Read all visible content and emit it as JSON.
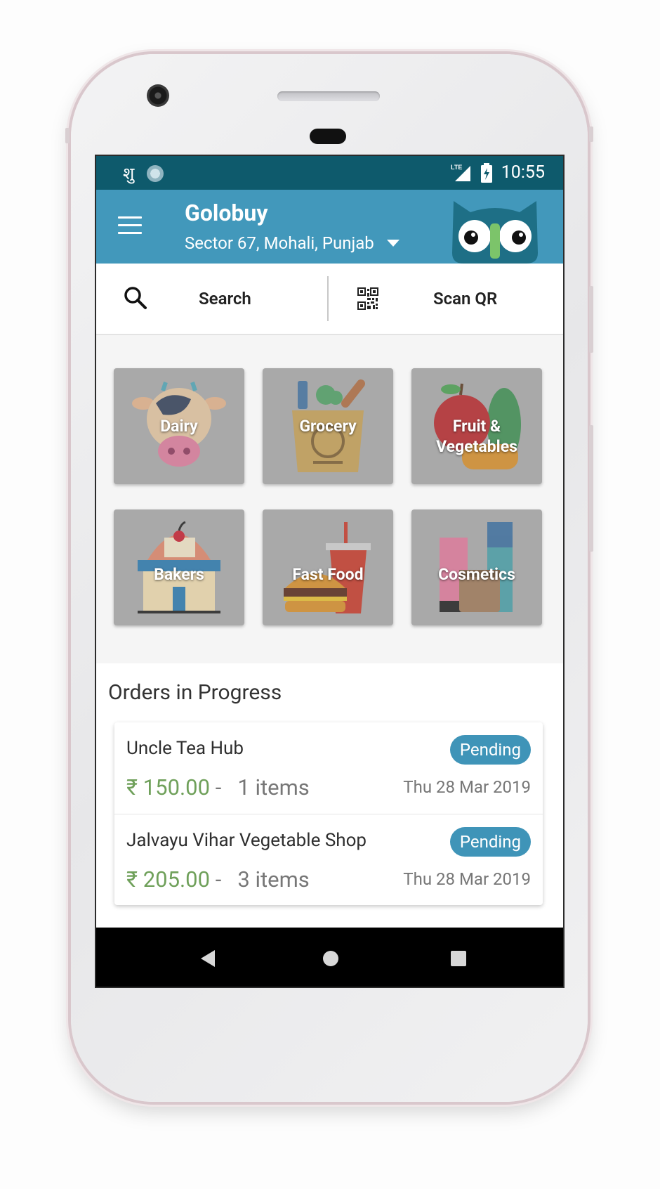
{
  "status_bar": {
    "left_glyph": "शु",
    "time": "10:55",
    "network": "LTE"
  },
  "app_bar": {
    "title": "Golobuy",
    "location": "Sector 67, Mohali, Punjab"
  },
  "search": {
    "search_label": "Search",
    "scan_label": "Scan QR"
  },
  "categories": [
    {
      "label": "Dairy",
      "icon": "cow-icon"
    },
    {
      "label": "Grocery",
      "icon": "grocery-bag-icon"
    },
    {
      "label": "Fruit &\nVegetables",
      "icon": "fruit-vegetables-icon"
    },
    {
      "label": "Bakers",
      "icon": "bakery-shop-icon"
    },
    {
      "label": "Fast Food",
      "icon": "burger-drink-icon"
    },
    {
      "label": "Cosmetics",
      "icon": "cosmetics-icon"
    }
  ],
  "orders": {
    "title": "Orders in Progress",
    "items": [
      {
        "shop": "Uncle Tea Hub",
        "status": "Pending",
        "price": "₹ 150.00",
        "separator": " -   ",
        "items": "1 items",
        "date": "Thu 28 Mar 2019"
      },
      {
        "shop": "Jalvayu Vihar Vegetable Shop",
        "status": "Pending",
        "price": "₹ 205.00",
        "separator": " -   ",
        "items": "3 items",
        "date": "Thu 28 Mar 2019"
      }
    ]
  },
  "colors": {
    "status_bar": "#0e5a6c",
    "app_bar": "#4298bb",
    "price": "#6fa05a",
    "badge": "#3f94b8"
  }
}
